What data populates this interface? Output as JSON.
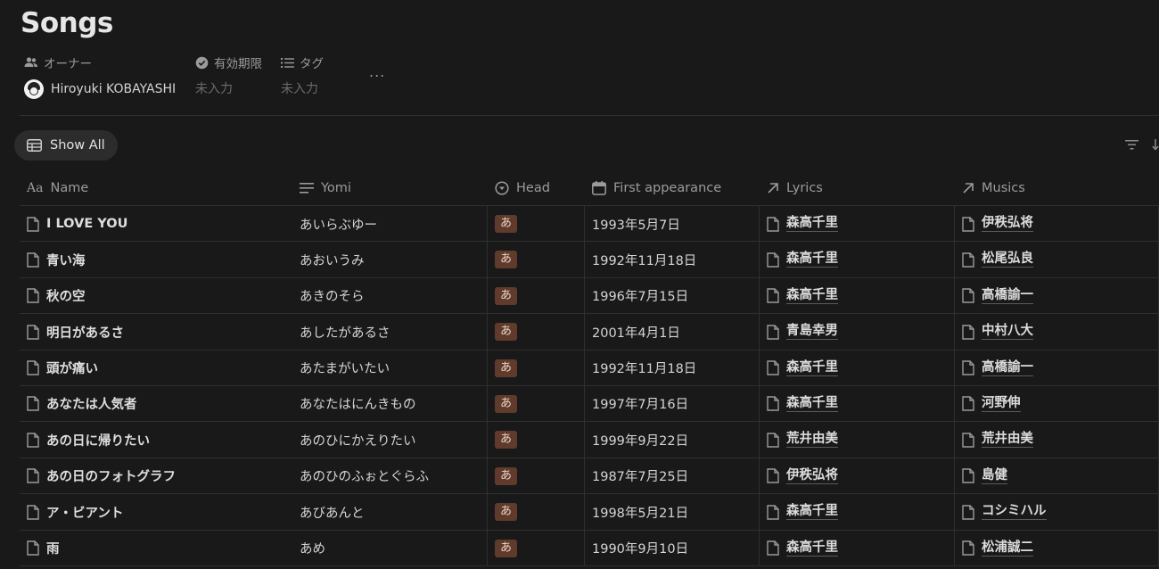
{
  "page": {
    "title": "Songs"
  },
  "properties": {
    "owner": {
      "label": "オーナー",
      "icon": "people-icon",
      "value": "Hiroyuki KOBAYASHI"
    },
    "expiry": {
      "label": "有効期限",
      "icon": "verified-badge-icon",
      "value": "未入力"
    },
    "tags": {
      "label": "タグ",
      "icon": "list-icon",
      "value": "未入力"
    },
    "more": "..."
  },
  "view": {
    "tab_label": "Show All",
    "icon": "table-icon"
  },
  "table": {
    "columns": [
      {
        "key": "name",
        "label": "Name",
        "icon": "text-type-icon"
      },
      {
        "key": "yomi",
        "label": "Yomi",
        "icon": "text-lines-icon"
      },
      {
        "key": "head",
        "label": "Head",
        "icon": "select-icon"
      },
      {
        "key": "first",
        "label": "First appearance",
        "icon": "calendar-icon"
      },
      {
        "key": "lyrics",
        "label": "Lyrics",
        "icon": "relation-arrow-icon"
      },
      {
        "key": "musics",
        "label": "Musics",
        "icon": "relation-arrow-icon"
      }
    ],
    "rows": [
      {
        "name": "I LOVE YOU",
        "yomi": "あいらぶゆー",
        "head": "あ",
        "first": "1993年5月7日",
        "lyrics": "森高千里",
        "musics": "伊秩弘将"
      },
      {
        "name": "青い海",
        "yomi": "あおいうみ",
        "head": "あ",
        "first": "1992年11月18日",
        "lyrics": "森高千里",
        "musics": "松尾弘良"
      },
      {
        "name": "秋の空",
        "yomi": "あきのそら",
        "head": "あ",
        "first": "1996年7月15日",
        "lyrics": "森高千里",
        "musics": "高橋諭一"
      },
      {
        "name": "明日があるさ",
        "yomi": "あしたがあるさ",
        "head": "あ",
        "first": "2001年4月1日",
        "lyrics": "青島幸男",
        "musics": "中村八大"
      },
      {
        "name": "頭が痛い",
        "yomi": "あたまがいたい",
        "head": "あ",
        "first": "1992年11月18日",
        "lyrics": "森高千里",
        "musics": "高橋諭一"
      },
      {
        "name": "あなたは人気者",
        "yomi": "あなたはにんきもの",
        "head": "あ",
        "first": "1997年7月16日",
        "lyrics": "森高千里",
        "musics": "河野伸"
      },
      {
        "name": "あの日に帰りたい",
        "yomi": "あのひにかえりたい",
        "head": "あ",
        "first": "1999年9月22日",
        "lyrics": "荒井由美",
        "musics": "荒井由美"
      },
      {
        "name": "あの日のフォトグラフ",
        "yomi": "あのひのふぉとぐらふ",
        "head": "あ",
        "first": "1987年7月25日",
        "lyrics": "伊秩弘将",
        "musics": "島健"
      },
      {
        "name": "ア・ビアント",
        "yomi": "あびあんと",
        "head": "あ",
        "first": "1998年5月21日",
        "lyrics": "森高千里",
        "musics": "コシミハル"
      },
      {
        "name": "雨",
        "yomi": "あめ",
        "head": "あ",
        "first": "1990年9月10日",
        "lyrics": "森高千里",
        "musics": "松浦誠二"
      }
    ]
  },
  "colors": {
    "background": "#191919",
    "badge": "#603b2c",
    "badge_text": "#e8d4c8"
  }
}
